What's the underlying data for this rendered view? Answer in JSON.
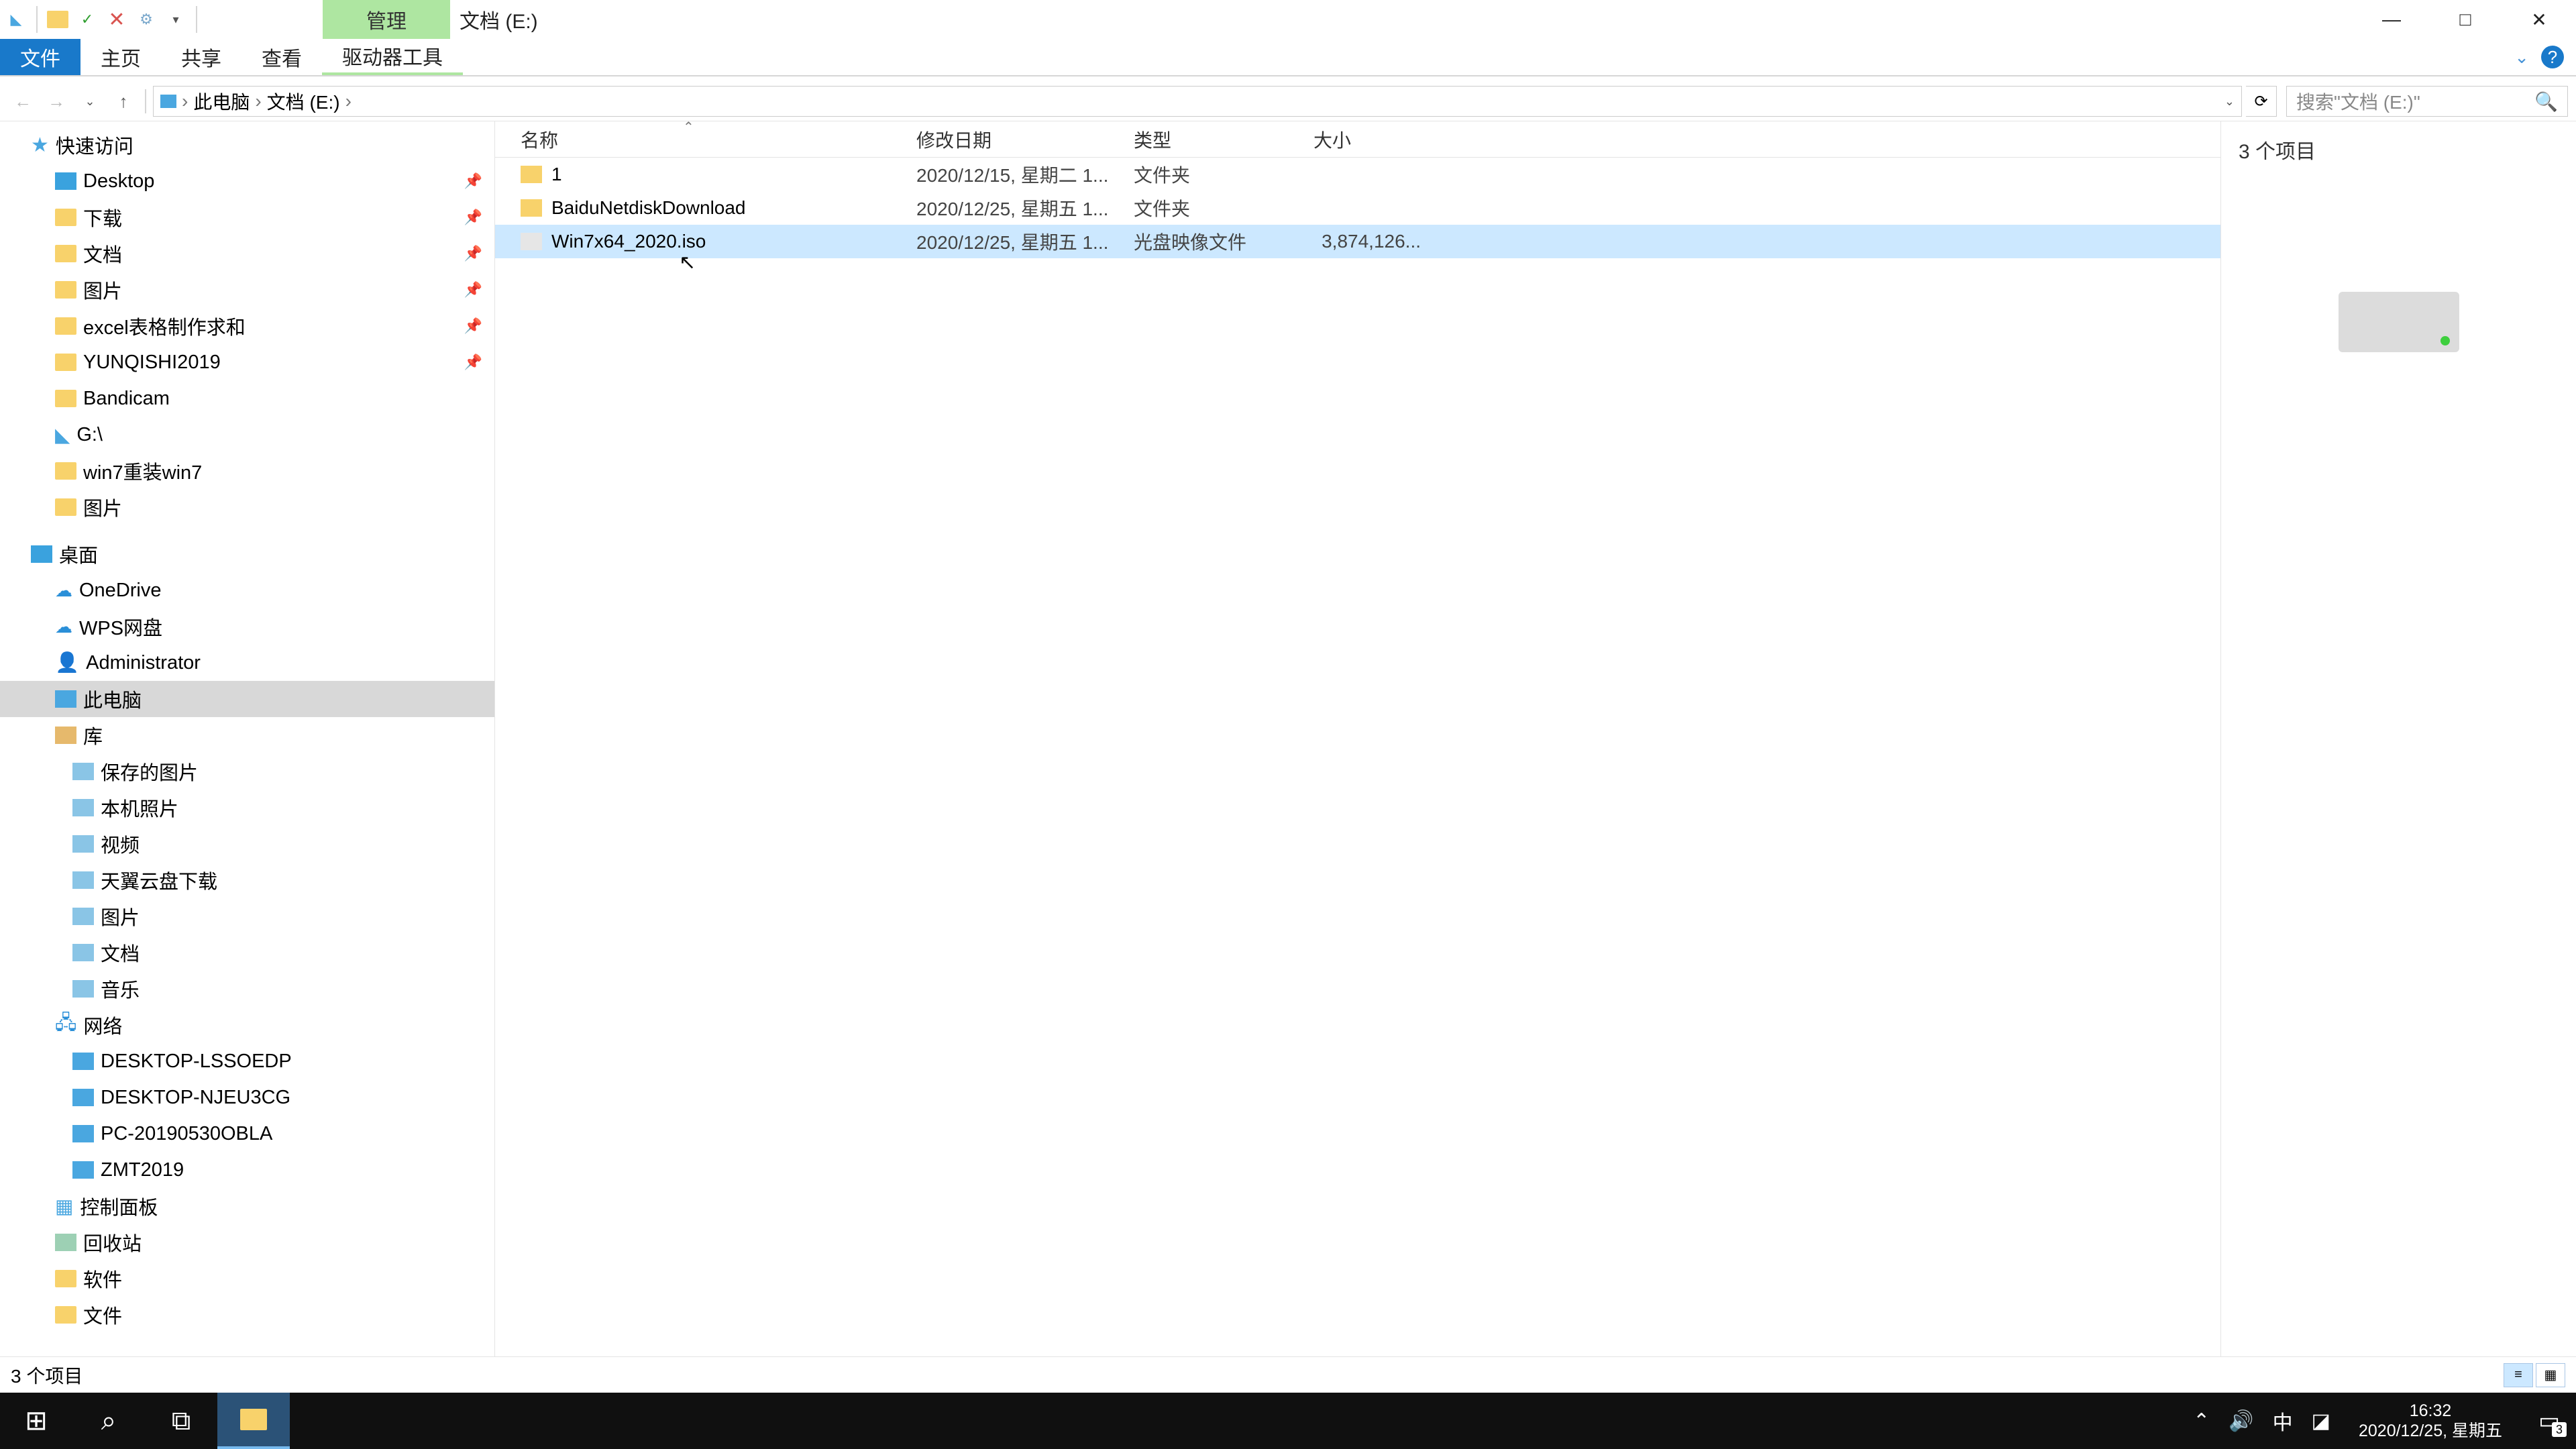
{
  "title_context_tab": "管理",
  "window_title": "文档 (E:)",
  "ribbon": {
    "file": "文件",
    "home": "主页",
    "share": "共享",
    "view": "查看",
    "drive_tools": "驱动器工具"
  },
  "breadcrumbs": {
    "this_pc": "此电脑",
    "location": "文档 (E:)"
  },
  "search_placeholder": "搜索\"文档 (E:)\"",
  "tree": {
    "quick_access": "快速访问",
    "desktop": "Desktop",
    "downloads": "下载",
    "documents": "文档",
    "pictures": "图片",
    "excel": "excel表格制作求和",
    "yunqishi": "YUNQISHI2019",
    "bandicam": "Bandicam",
    "gdrive": "G:\\",
    "win7reinstall": "win7重装win7",
    "pictures2": "图片",
    "desktop2": "桌面",
    "onedrive": "OneDrive",
    "wps": "WPS网盘",
    "administrator": "Administrator",
    "this_pc": "此电脑",
    "libraries": "库",
    "saved_pics": "保存的图片",
    "local_photos": "本机照片",
    "videos": "视频",
    "tianyi": "天翼云盘下载",
    "pictures3": "图片",
    "documents2": "文档",
    "music": "音乐",
    "network": "网络",
    "pc1": "DESKTOP-LSSOEDP",
    "pc2": "DESKTOP-NJEU3CG",
    "pc3": "PC-20190530OBLA",
    "pc4": "ZMT2019",
    "control_panel": "控制面板",
    "recycle": "回收站",
    "software": "软件",
    "files": "文件"
  },
  "columns": {
    "name": "名称",
    "date": "修改日期",
    "type": "类型",
    "size": "大小"
  },
  "files": [
    {
      "name": "1",
      "date": "2020/12/15, 星期二 1...",
      "type": "文件夹",
      "size": "",
      "icon": "folder",
      "selected": false
    },
    {
      "name": "BaiduNetdiskDownload",
      "date": "2020/12/25, 星期五 1...",
      "type": "文件夹",
      "size": "",
      "icon": "folder",
      "selected": false
    },
    {
      "name": "Win7x64_2020.iso",
      "date": "2020/12/25, 星期五 1...",
      "type": "光盘映像文件",
      "size": "3,874,126...",
      "icon": "iso",
      "selected": true
    }
  ],
  "preview_title": "3 个项目",
  "status_text": "3 个项目",
  "taskbar": {
    "time": "16:32",
    "date": "2020/12/25, 星期五",
    "ime": "中",
    "notif_count": "3"
  }
}
